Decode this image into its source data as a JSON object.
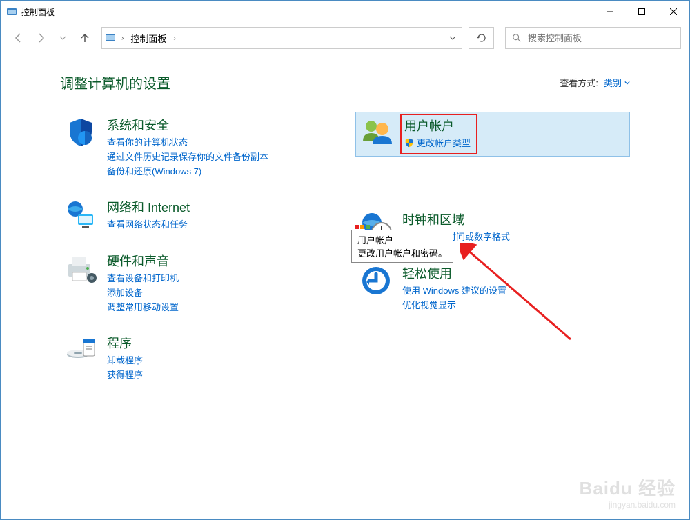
{
  "window": {
    "title": "控制面板"
  },
  "nav": {
    "breadcrumb_item": "控制面板",
    "search_placeholder": "搜索控制面板"
  },
  "header": {
    "page_title": "调整计算机的设置",
    "view_label": "查看方式:",
    "view_value": "类别"
  },
  "left_categories": [
    {
      "title": "系统和安全",
      "links": [
        "查看你的计算机状态",
        "通过文件历史记录保存你的文件备份副本",
        "备份和还原(Windows 7)"
      ]
    },
    {
      "title": "网络和 Internet",
      "links": [
        "查看网络状态和任务"
      ]
    },
    {
      "title": "硬件和声音",
      "links": [
        "查看设备和打印机",
        "添加设备",
        "调整常用移动设置"
      ]
    },
    {
      "title": "程序",
      "links": [
        "卸载程序",
        "获得程序"
      ]
    }
  ],
  "right_categories": [
    {
      "title": "用户帐户",
      "links": [
        "更改帐户类型"
      ],
      "shield": true,
      "highlighted": true
    },
    {
      "title": "时钟和区域",
      "links": [
        "更改日期、时间或数字格式"
      ]
    },
    {
      "title": "轻松使用",
      "links": [
        "使用 Windows 建议的设置",
        "优化视觉显示"
      ]
    }
  ],
  "tooltip": {
    "title": "用户帐户",
    "desc": "更改用户帐户和密码。"
  },
  "watermark": {
    "brand": "Baidu 经验",
    "url": "jingyan.baidu.com"
  }
}
